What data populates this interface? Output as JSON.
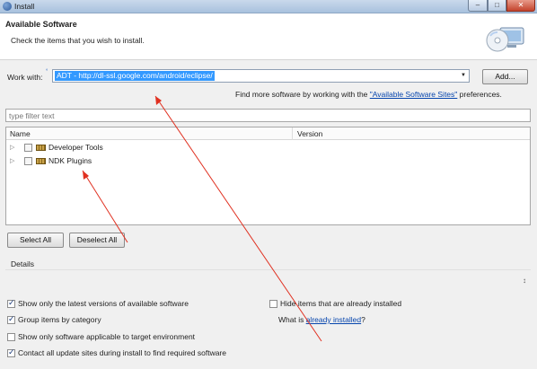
{
  "window": {
    "title": "Install",
    "minimize_glyph": "–",
    "maximize_glyph": "□",
    "close_glyph": "✕"
  },
  "header": {
    "title": "Available Software",
    "description": "Check the items that you wish to install.",
    "icon": "software-cd-icon"
  },
  "work_with": {
    "label": "Work with:",
    "help_glyph": "°",
    "value": "ADT - http://dl-ssl.google.com/android/eclipse/",
    "add_label": "Add...",
    "find_more_prefix": "Find more software by working with the ",
    "find_more_link": "\"Available Software Sites\"",
    "find_more_suffix": " preferences."
  },
  "filter": {
    "placeholder": "type filter text"
  },
  "tree": {
    "columns": [
      "Name",
      "Version"
    ],
    "items": [
      {
        "label": "Developer Tools",
        "checked": false
      },
      {
        "label": "NDK Plugins",
        "checked": false
      }
    ],
    "expand_glyph": "▷"
  },
  "buttons": {
    "select_all": "Select All",
    "deselect_all": "Deselect All"
  },
  "details": {
    "label": "Details",
    "scroll_glyph": "↕"
  },
  "options": {
    "latest_versions": {
      "label": "Show only the latest versions of available software",
      "checked": true
    },
    "group_by_category": {
      "label": "Group items by category",
      "checked": true
    },
    "target_env": {
      "label": "Show only software applicable to target environment",
      "checked": false
    },
    "contact_sites": {
      "label": "Contact all update sites during install to find required software",
      "checked": true
    },
    "hide_installed": {
      "label": "Hide items that are already installed",
      "checked": false
    },
    "installed_prefix": "What is ",
    "installed_link": "already installed",
    "installed_suffix": "?"
  },
  "colors": {
    "selection": "#3399ff",
    "link": "#0645ad",
    "annotation": "#e03020"
  }
}
